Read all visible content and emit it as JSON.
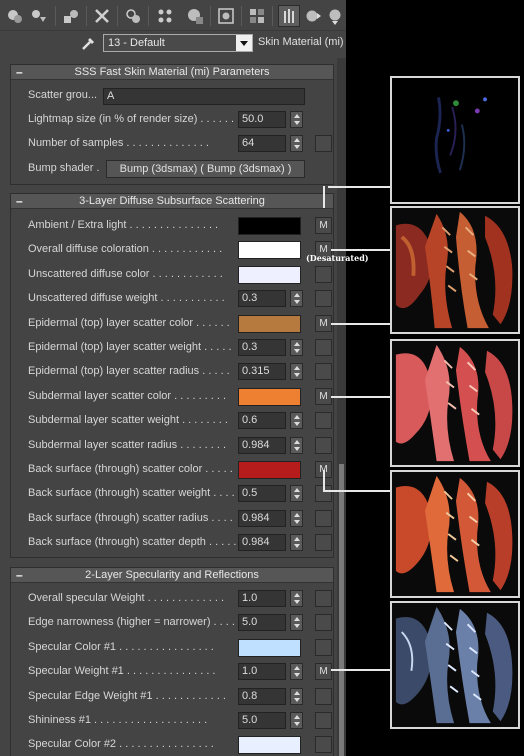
{
  "material": {
    "selected": "13 - Default",
    "type": "Skin Material (mi)"
  },
  "toolbar": {
    "icons": [
      "get-material-icon",
      "put-to-scene-icon",
      "assign-material-icon",
      "reset-map-icon",
      "make-unique-icon",
      "put-to-library-icon",
      "material-id-channel-icon",
      "show-map-in-viewport-icon",
      "show-end-result-icon",
      "go-to-parent-icon",
      "go-forward-to-sibling-icon"
    ]
  },
  "rollouts": {
    "sss": {
      "title": "SSS Fast Skin Material (mi) Parameters",
      "scatter_group_label": "Scatter grou...",
      "scatter_group_value": "A",
      "lightmap_label": "Lightmap size (in % of render size) . . . . . .",
      "lightmap_value": "50.0",
      "samples_label": "Number of samples . . . . . . . . . . . . . .",
      "samples_value": "64",
      "bump_label": "Bump shader .",
      "bump_button": "Bump (3dsmax)  ( Bump (3dsmax) )"
    },
    "diffuse": {
      "title": "3-Layer Diffuse Subsurface Scattering",
      "rows": [
        {
          "label": "Ambient / Extra light . . . . . . . . . . . . . . .",
          "kind": "color",
          "color": "#000000",
          "map": "M"
        },
        {
          "label": "Overall diffuse coloration . . . . . . . . . . . .",
          "kind": "color",
          "color": "#ffffff",
          "map": "M"
        },
        {
          "label": "Unscattered diffuse color . . . . . . . . . . . .",
          "kind": "color",
          "color": "#eef0ff",
          "map": ""
        },
        {
          "label": "Unscattered diffuse weight . . . . . . . . . . .",
          "kind": "value",
          "value": "0.3",
          "map": ""
        },
        {
          "label": "Epidermal (top) layer scatter color . . . . . .",
          "kind": "color",
          "color": "#b67a3e",
          "map": "M"
        },
        {
          "label": "Epidermal (top) layer scatter weight . . . . .",
          "kind": "value",
          "value": "0.3",
          "map": ""
        },
        {
          "label": "Epidermal (top) layer scatter radius . . . . .",
          "kind": "value",
          "value": "0.315",
          "map": ""
        },
        {
          "label": "Subdermal layer scatter color . . . . . . . . .",
          "kind": "color",
          "color": "#ee8032",
          "map": "M"
        },
        {
          "label": "Subdermal layer scatter weight . . . . . . . .",
          "kind": "value",
          "value": "0.6",
          "map": ""
        },
        {
          "label": "Subdermal layer scatter radius . . . . . . . .",
          "kind": "value",
          "value": "0.984",
          "map": ""
        },
        {
          "label": "Back surface (through) scatter color . . . . .",
          "kind": "color",
          "color": "#b71c1c",
          "map": "M"
        },
        {
          "label": "Back surface (through) scatter weight . . . .",
          "kind": "value",
          "value": "0.5",
          "map": ""
        },
        {
          "label": "Back surface (through) scatter radius . . . .",
          "kind": "value",
          "value": "0.984",
          "map": ""
        },
        {
          "label": "Back surface (through) scatter depth . . . . .",
          "kind": "value",
          "value": "0.984",
          "map": ""
        }
      ]
    },
    "specular": {
      "title": "2-Layer Specularity and Reflections",
      "rows": [
        {
          "label": "Overall specular Weight . . . . . . . . . . . . .",
          "kind": "value",
          "value": "1.0",
          "map": ""
        },
        {
          "label": "Edge narrowness (higher = narrower) . . . .",
          "kind": "value",
          "value": "5.0",
          "map": ""
        },
        {
          "label": "Specular Color #1 . . . . . . . . . . . . . . . .",
          "kind": "color",
          "color": "#bfe0ff",
          "map": ""
        },
        {
          "label": "Specular Weight #1 . . . . . . . . . . . . . . .",
          "kind": "value",
          "value": "1.0",
          "map": "M"
        },
        {
          "label": "Specular Edge Weight #1 . . . . . . . . . . . .",
          "kind": "value",
          "value": "0.8",
          "map": ""
        },
        {
          "label": "Shininess #1 . . . . . . . . . . . . . . . . . . .",
          "kind": "value",
          "value": "5.0",
          "map": ""
        },
        {
          "label": "Specular Color #2 . . . . . . . . . . . . . . . .",
          "kind": "color",
          "color": "#e8f0ff",
          "map": ""
        }
      ]
    }
  },
  "annotations": {
    "desaturated": "(Desaturated)"
  },
  "thumbnails": [
    {
      "name": "ambient-map-thumbnail",
      "theme": "dark"
    },
    {
      "name": "diffuse-map-thumbnail",
      "theme": "red"
    },
    {
      "name": "epidermal-map-thumbnail",
      "theme": "pink"
    },
    {
      "name": "subdermal-map-thumbnail",
      "theme": "orange"
    },
    {
      "name": "specular-map-thumbnail",
      "theme": "blue"
    }
  ]
}
